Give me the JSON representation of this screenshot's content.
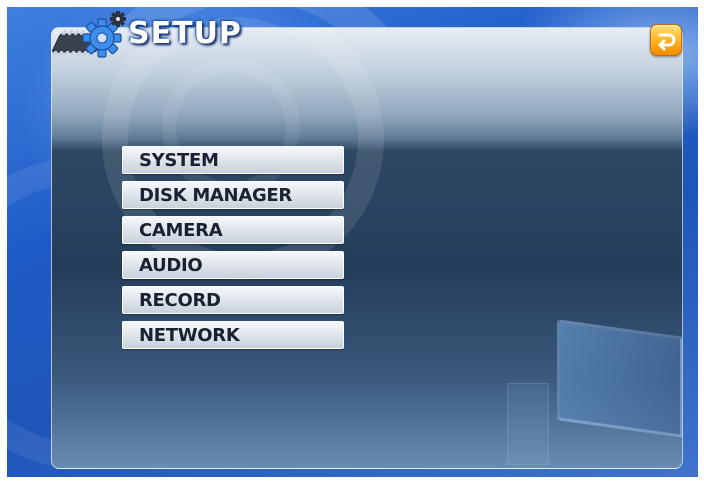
{
  "window": {
    "title": "SETUP"
  },
  "header": {
    "icons": [
      "chip-icon",
      "gear-icon"
    ],
    "exit_icon": "return-arrow-icon"
  },
  "menu": {
    "items": [
      {
        "label": "SYSTEM"
      },
      {
        "label": "DISK MANAGER"
      },
      {
        "label": "CAMERA"
      },
      {
        "label": "AUDIO"
      },
      {
        "label": "RECORD"
      },
      {
        "label": "NETWORK"
      }
    ]
  },
  "colors": {
    "desktop_blue": "#1f5bc6",
    "panel_dark": "#243d5a",
    "menu_button": "#dfe5ec",
    "menu_text": "#1a2230",
    "exit_orange": "#ffb21c"
  }
}
